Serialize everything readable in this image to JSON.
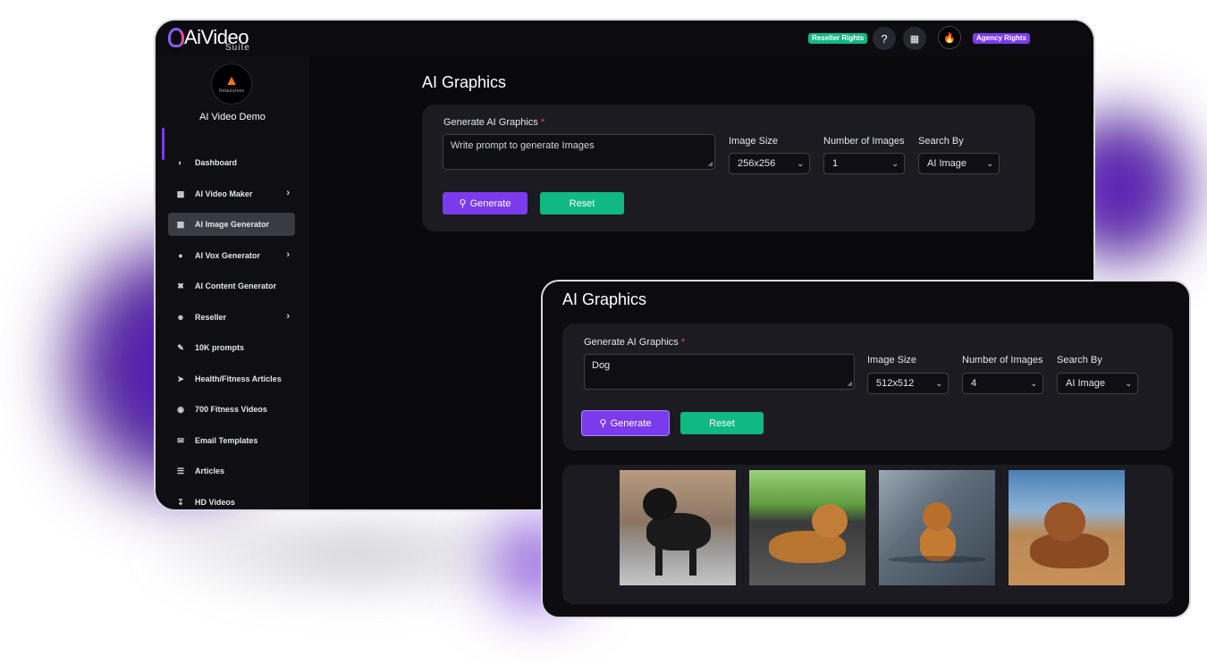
{
  "app": {
    "logo_text": "AiVideo",
    "logo_sub": "Suite",
    "badges": {
      "reseller": "Reseller Rights",
      "agency": "Agency Rights"
    },
    "help_icon": "question-circle-icon",
    "store_icon": "store-icon"
  },
  "sidebar": {
    "user_name": "AI Video Demo",
    "avatar_text": "Relaunchers",
    "items": [
      {
        "label": "Dashboard",
        "icon": "gauge-icon",
        "has_chevron": false
      },
      {
        "label": "AI Video Maker",
        "icon": "video-icon",
        "has_chevron": true
      },
      {
        "label": "AI Image Generator",
        "icon": "image-icon",
        "has_chevron": false,
        "active": true
      },
      {
        "label": "AI Vox Generator",
        "icon": "microphone-icon",
        "has_chevron": true
      },
      {
        "label": "AI Content Generator",
        "icon": "tools-icon",
        "has_chevron": false
      },
      {
        "label": "Reseller",
        "icon": "users-icon",
        "has_chevron": true
      },
      {
        "label": "10K prompts",
        "icon": "pen-icon",
        "has_chevron": false
      },
      {
        "label": "Health/Fitness Articles",
        "icon": "send-icon",
        "has_chevron": false
      },
      {
        "label": "700 Fitness Videos",
        "icon": "play-circle-icon",
        "has_chevron": false
      },
      {
        "label": "Email Templates",
        "icon": "envelope-icon",
        "has_chevron": false
      },
      {
        "label": "Articles",
        "icon": "list-icon",
        "has_chevron": false
      },
      {
        "label": "HD Videos",
        "icon": "download-icon",
        "has_chevron": false
      }
    ]
  },
  "back_form": {
    "title": "AI Graphics",
    "generate_label": "Generate AI Graphics",
    "required_mark": "*",
    "prompt_placeholder": "Write prompt to generate Images",
    "prompt_value": "",
    "image_size_label": "Image Size",
    "image_size_value": "256x256",
    "num_images_label": "Number of Images",
    "num_images_value": "1",
    "search_by_label": "Search By",
    "search_by_value": "AI Image",
    "generate_button": "Generate",
    "reset_button": "Reset"
  },
  "front_form": {
    "title": "AI Graphics",
    "generate_label": "Generate AI Graphics",
    "required_mark": "*",
    "prompt_value": "Dog",
    "image_size_label": "Image Size",
    "image_size_value": "512x512",
    "num_images_label": "Number of Images",
    "num_images_value": "4",
    "search_by_label": "Search By",
    "search_by_value": "AI Image",
    "generate_button": "Generate",
    "reset_button": "Reset"
  },
  "colors": {
    "accent_purple": "#7c3aed",
    "accent_green": "#10b981",
    "background": "#0c0c10",
    "card": "#1b1b21"
  }
}
